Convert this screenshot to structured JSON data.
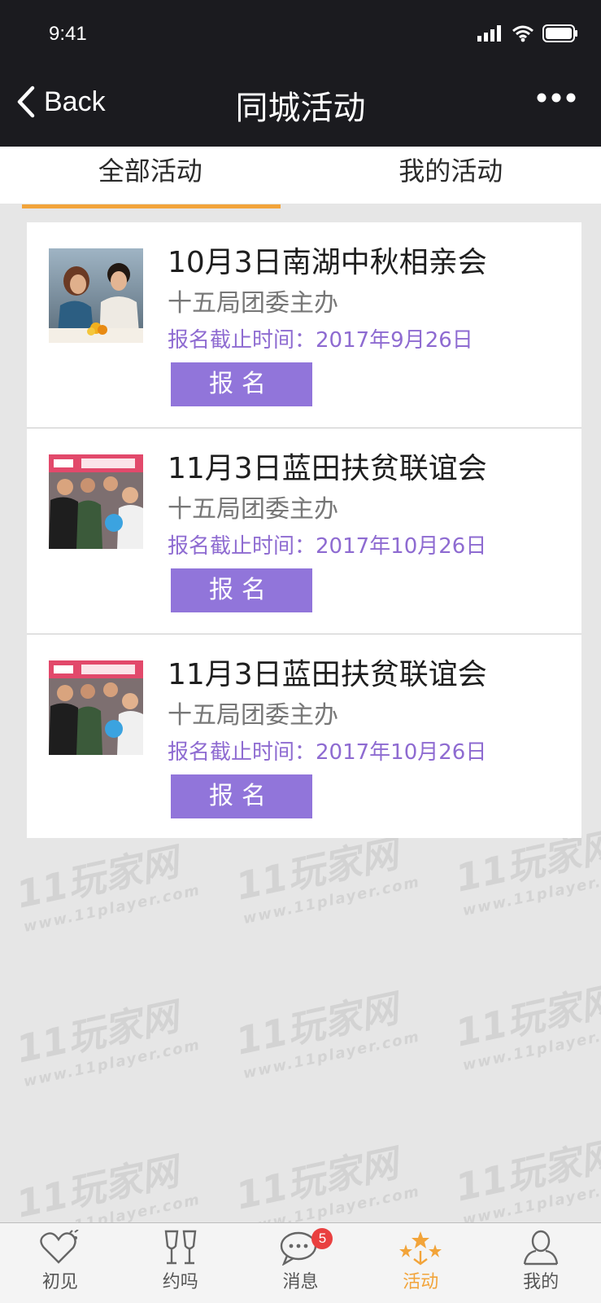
{
  "status_bar": {
    "time": "9:41"
  },
  "nav": {
    "back_label": "Back",
    "title": "同城活动",
    "more_icon": "more-dots-icon"
  },
  "tabs": [
    {
      "label": "全部活动",
      "active": true
    },
    {
      "label": "我的活动",
      "active": false
    }
  ],
  "events": [
    {
      "title": "10月3日南湖中秋相亲会",
      "organizer": "十五局团委主办",
      "deadline": "报名截止时间：2017年9月26日",
      "button": "报名"
    },
    {
      "title": "11月3日蓝田扶贫联谊会",
      "organizer": "十五局团委主办",
      "deadline": "报名截止时间：2017年10月26日",
      "button": "报名"
    },
    {
      "title": "11月3日蓝田扶贫联谊会",
      "organizer": "十五局团委主办",
      "deadline": "报名截止时间：2017年10月26日",
      "button": "报名"
    }
  ],
  "watermark": {
    "brand": "11玩家网",
    "url": "www.11player.com"
  },
  "tabbar": [
    {
      "label": "初见",
      "icon": "heart-icon",
      "active": false
    },
    {
      "label": "约吗",
      "icon": "wine-glasses-icon",
      "active": false
    },
    {
      "label": "消息",
      "icon": "chat-bubble-icon",
      "active": false,
      "badge": "5"
    },
    {
      "label": "活动",
      "icon": "fireworks-icon",
      "active": true
    },
    {
      "label": "我的",
      "icon": "person-icon",
      "active": false
    }
  ],
  "colors": {
    "accent": "#f2a43a",
    "button": "#9175da",
    "deadline": "#8e6bd1",
    "badge": "#e94040"
  }
}
